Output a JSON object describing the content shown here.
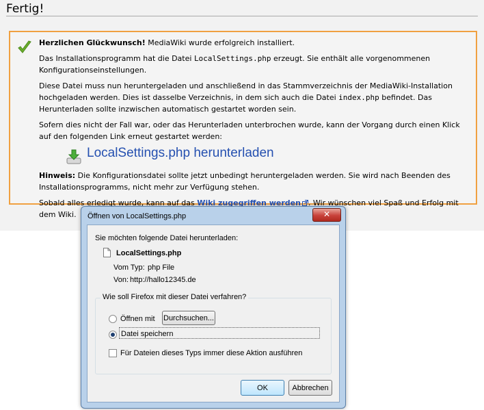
{
  "page": {
    "heading": "Fertig!"
  },
  "success": {
    "intro_bold": "Herzlichen Glückwunsch!",
    "intro_rest": " MediaWiki wurde erfolgreich installiert.",
    "p2_a": "Das Installationsprogramm hat die Datei ",
    "p2_code": "LocalSettings.php",
    "p2_b": " erzeugt. Sie enthält alle vorgenommenen Konfigurationseinstellungen.",
    "p3_a": "Diese Datei muss nun heruntergeladen und anschließend in das Stammverzeichnis der MediaWiki-Installation hochgeladen werden. Dies ist dasselbe Verzeichnis, in dem sich auch die Datei ",
    "p3_code": "index.php",
    "p3_b": " befindet. Das Herunterladen sollte inzwischen automatisch gestartet worden sein.",
    "p4": "Sofern dies nicht der Fall war, oder das Herunterladen unterbrochen wurde, kann der Vorgang durch einen Klick auf den folgenden Link erneut gestartet werden:",
    "download_link": "LocalSettings.php herunterladen",
    "hint_bold": "Hinweis:",
    "hint_rest": " Die Konfigurationsdatei sollte jetzt unbedingt heruntergeladen werden. Sie wird nach Beenden des Installationsprogramms, nicht mehr zur Verfügung stehen.",
    "p6_a": "Sobald alles erledigt wurde, kann auf das ",
    "wiki_link": "Wiki zugegriffen werden",
    "p6_b": ". Wir wünschen viel Spaß und Erfolg mit dem Wiki.",
    "accent_border": "#f0a040",
    "link_color": "#2550b0"
  },
  "dialog": {
    "title": "Öffnen von LocalSettings.php",
    "close_glyph": "✕",
    "intro": "Sie möchten folgende Datei herunterladen:",
    "file_name": "LocalSettings.php",
    "type_label": "Vom Typ:",
    "type_value": "php File",
    "from_label": "Von:",
    "from_value": "http://hallo12345.de",
    "question": "Wie soll Firefox mit dieser Datei verfahren?",
    "open_with_label": "Öffnen mit",
    "browse_label": "Durchsuchen...",
    "save_label": "Datei speichern",
    "always_label": "Für Dateien dieses Typs immer diese Aktion ausführen",
    "ok_label": "OK",
    "cancel_label": "Abbrechen",
    "selected_option": "save",
    "always_checked": false
  }
}
